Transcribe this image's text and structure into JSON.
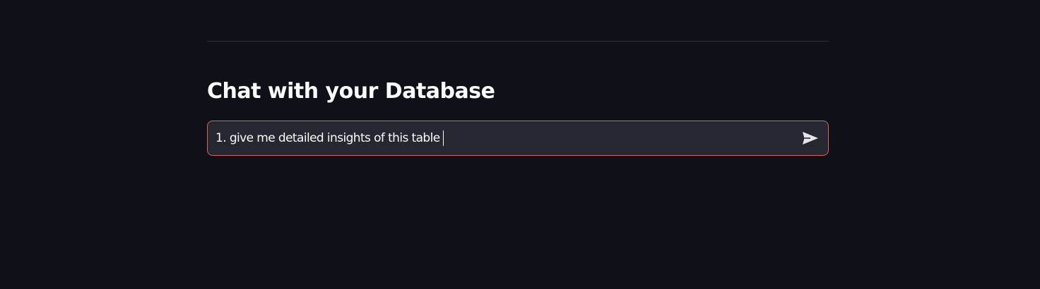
{
  "page": {
    "title": "Chat with your Database"
  },
  "chat": {
    "input_value": "1. give me detailed insights of this table",
    "send_icon": "send-icon"
  },
  "colors": {
    "background": "#0e1117",
    "input_background": "#262730",
    "input_border_focus": "#e35d62",
    "text": "#fafafa"
  }
}
